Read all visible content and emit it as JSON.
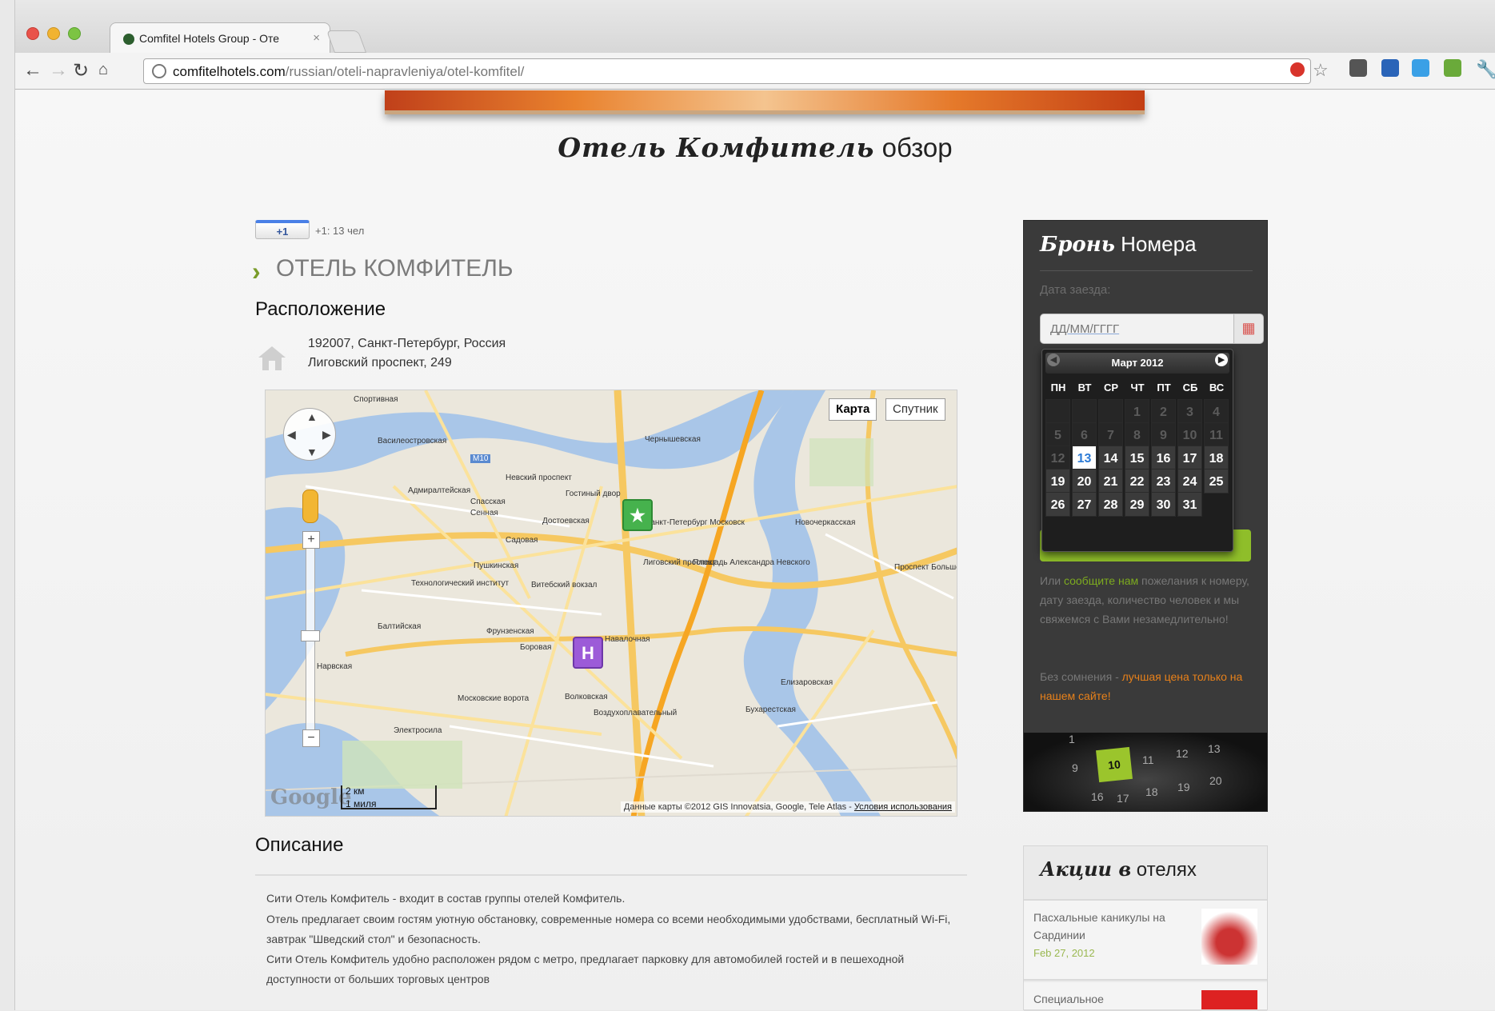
{
  "browser": {
    "tab_title": "Comfitel Hotels Group - Оте",
    "tab_close": "×",
    "url_host": "comfitelhotels.com",
    "url_path": "/russian/oteli-napravleniya/otel-komfitel/"
  },
  "page": {
    "title_script": "Отель Комфитель",
    "title_plain": " обзор",
    "gplus_label": "+1",
    "gplus_count": "+1: 13 чел",
    "hotel_heading": "ОТЕЛЬ КОМФИТЕЛЬ",
    "location_heading": "Расположение",
    "address_line1": "192007, Санкт-Петербург, Россия",
    "address_line2": "Лиговский проспект, 249",
    "description_heading": "Описание",
    "paragraphs": [
      "Сити Отель Комфитель - входит в состав группы отелей Комфитель.",
      "Отель предлагает своим гостям уютную обстановку, современные номера со всеми необходимыми удобствами, бесплатный Wi-Fi, завтрак \"Шведский стол\" и безопасность.",
      "Сити Отель Комфитель удобно расположен рядом с метро, предлагает парковку для автомобилей гостей и в пешеходной доступности от больших торговых центров"
    ]
  },
  "map": {
    "type_map": "Карта",
    "type_satellite": "Спутник",
    "google_logo": "Google",
    "scale_km": "2 км",
    "scale_mi": "1 миля",
    "attribution": "Данные карты ©2012 GIS Innovatsia, Google, Tele Atlas - ",
    "terms": "Условия использования",
    "hotel_marker": "H",
    "labels": [
      "Спортивная",
      "Василеостровская",
      "Адмиралтейская",
      "Невский проспект",
      "Гостиный двор",
      "Спасская",
      "Сенная",
      "Достоевская",
      "Садовая",
      "Пушкинская",
      "Технологический институт",
      "Витебский вокзал",
      "Балтийская",
      "Фрунзенская",
      "Нарвская",
      "Московские ворота",
      "Волковская",
      "Боровая",
      "Навалочная",
      "Лиговский проспект",
      "Площадь Александра Невского",
      "Санкт-Петербург Московск",
      "Новочеркасская",
      "Чернышевская",
      "Проспект Большевиков",
      "Елизаровская",
      "Воздухоплавательный",
      "Бухарестская",
      "Электросила",
      "M10"
    ]
  },
  "booking": {
    "title_script": "Бронь",
    "title_plain": " Номера",
    "date_label": "Дата заезда:",
    "date_placeholder": "ДД/ММ/ГГГГ",
    "calendar_month": "Март 2012",
    "weekdays": [
      "ПН",
      "ВТ",
      "СР",
      "ЧТ",
      "ПТ",
      "СБ",
      "ВС"
    ],
    "days": [
      "",
      "",
      "",
      "1",
      "2",
      "3",
      "4",
      "5",
      "6",
      "7",
      "8",
      "9",
      "10",
      "11",
      "12",
      "13",
      "14",
      "15",
      "16",
      "17",
      "18",
      "19",
      "20",
      "21",
      "22",
      "23",
      "24",
      "25",
      "26",
      "27",
      "28",
      "29",
      "30",
      "31"
    ],
    "today": "13",
    "contact_pre": "Или ",
    "contact_link": "сообщите нам",
    "contact_post": " пожелания к номеру, дату заезда, количество человек и мы свяжемся с Вами незамедлительно!",
    "price_pre": "Без сомнения - ",
    "price_link": "лучшая цена только на нашем сайте!",
    "clock_numbers": [
      "1",
      "9",
      "10",
      "11",
      "12",
      "13",
      "16",
      "17",
      "18",
      "19",
      "20"
    ]
  },
  "promos": {
    "title_script": "Акции в",
    "title_plain": " отелях",
    "items": [
      {
        "title": "Пасхальные каникулы на Сардинии",
        "date": "Feb 27, 2012"
      },
      {
        "title": "Специальное",
        "date": ""
      }
    ]
  },
  "colors": {
    "accent_green": "#8fbe2a",
    "link_orange": "#e8811a",
    "sidebar_dark": "#3a3a3a"
  }
}
